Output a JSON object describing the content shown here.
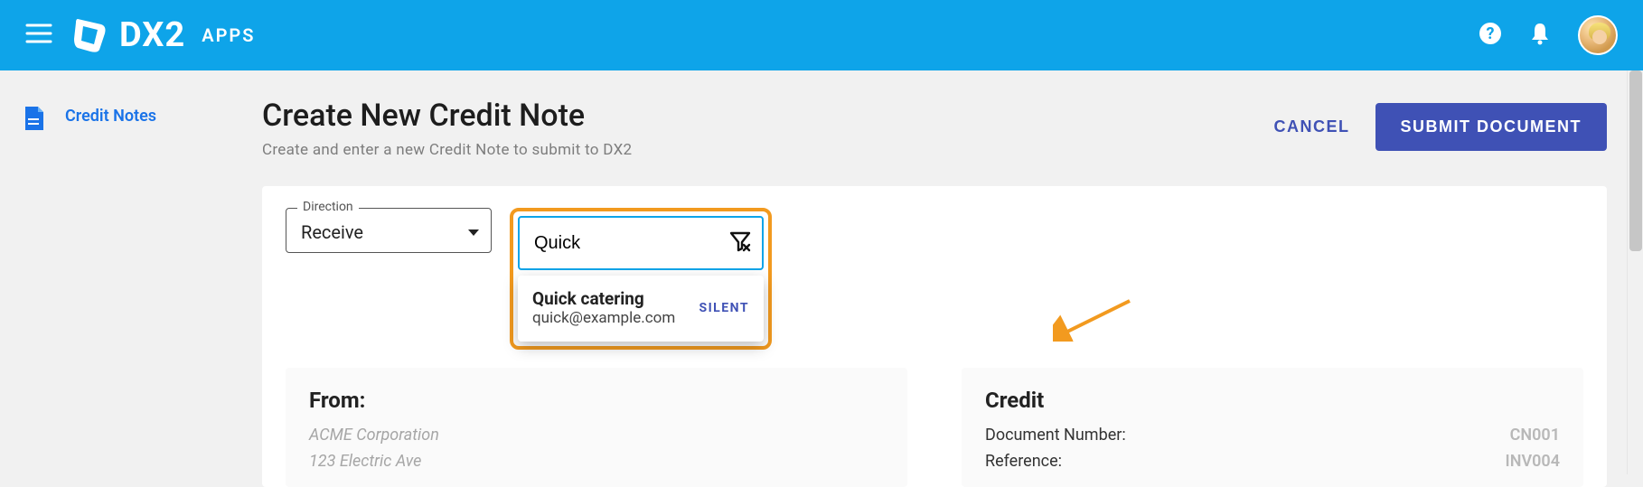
{
  "header": {
    "brand_name": "DX2",
    "brand_sub": "APPS"
  },
  "sidebar": {
    "link_label": "Credit Notes"
  },
  "page": {
    "title": "Create New Credit Note",
    "subtitle": "Create and enter a new Credit Note to submit to DX2"
  },
  "actions": {
    "cancel_label": "CANCEL",
    "submit_label": "SUBMIT DOCUMENT"
  },
  "form": {
    "direction_label": "Direction",
    "direction_value": "Receive",
    "search_value": "Quick",
    "suggestion": {
      "name": "Quick catering",
      "email": "quick@example.com",
      "badge": "SILENT"
    }
  },
  "from_panel": {
    "title": "From:",
    "company": "ACME Corporation",
    "address1": "123 Electric Ave"
  },
  "credit_panel": {
    "title": "Credit",
    "rows": [
      {
        "label": "Document Number:",
        "value": "CN001"
      },
      {
        "label": "Reference:",
        "value": "INV004"
      }
    ]
  }
}
